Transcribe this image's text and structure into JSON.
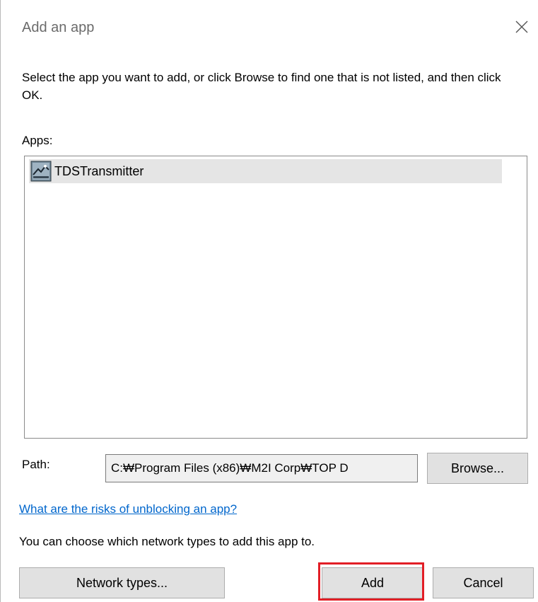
{
  "dialog": {
    "title": "Add an app",
    "instructions": "Select the app you want to add, or click Browse to find one that is not listed, and then click OK.",
    "apps_label": "Apps:",
    "apps": [
      {
        "label": "TDSTransmitter",
        "icon": "app-icon",
        "selected": true
      }
    ],
    "path_label": "Path:",
    "path_value": "C:₩Program Files (x86)₩M2I Corp₩TOP D",
    "browse_label": "Browse...",
    "risk_link": "What are the risks of unblocking an app?",
    "network_note": "You can choose which network types to add this app to.",
    "network_types_label": "Network types...",
    "add_label": "Add",
    "cancel_label": "Cancel",
    "highlight_color": "#e21e26",
    "link_color": "#0066cc"
  }
}
